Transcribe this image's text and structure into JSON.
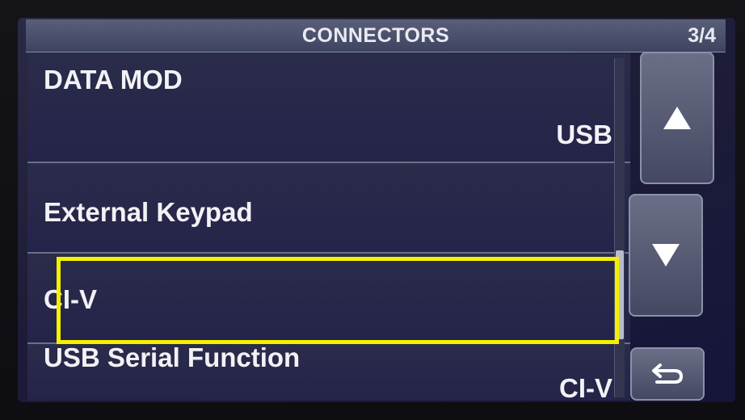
{
  "header": {
    "title": "CONNECTORS",
    "page_indicator": "3/4"
  },
  "menu": {
    "items": [
      {
        "label": "DATA MOD",
        "value": "USB"
      },
      {
        "label": "External Keypad",
        "value": ""
      },
      {
        "label": "CI-V",
        "value": ""
      },
      {
        "label": "USB Serial Function",
        "value": "CI-V"
      }
    ],
    "highlighted_item": "CI-V",
    "highlight_color": "#f4f000"
  },
  "controls": {
    "scroll_up_icon": "up-triangle-icon",
    "scroll_down_icon": "down-triangle-icon",
    "return_icon": "return-arrow-icon"
  },
  "colors": {
    "screen_bg": "#1d1d38",
    "text": "#f2f2f6",
    "highlight": "#f4f000"
  }
}
